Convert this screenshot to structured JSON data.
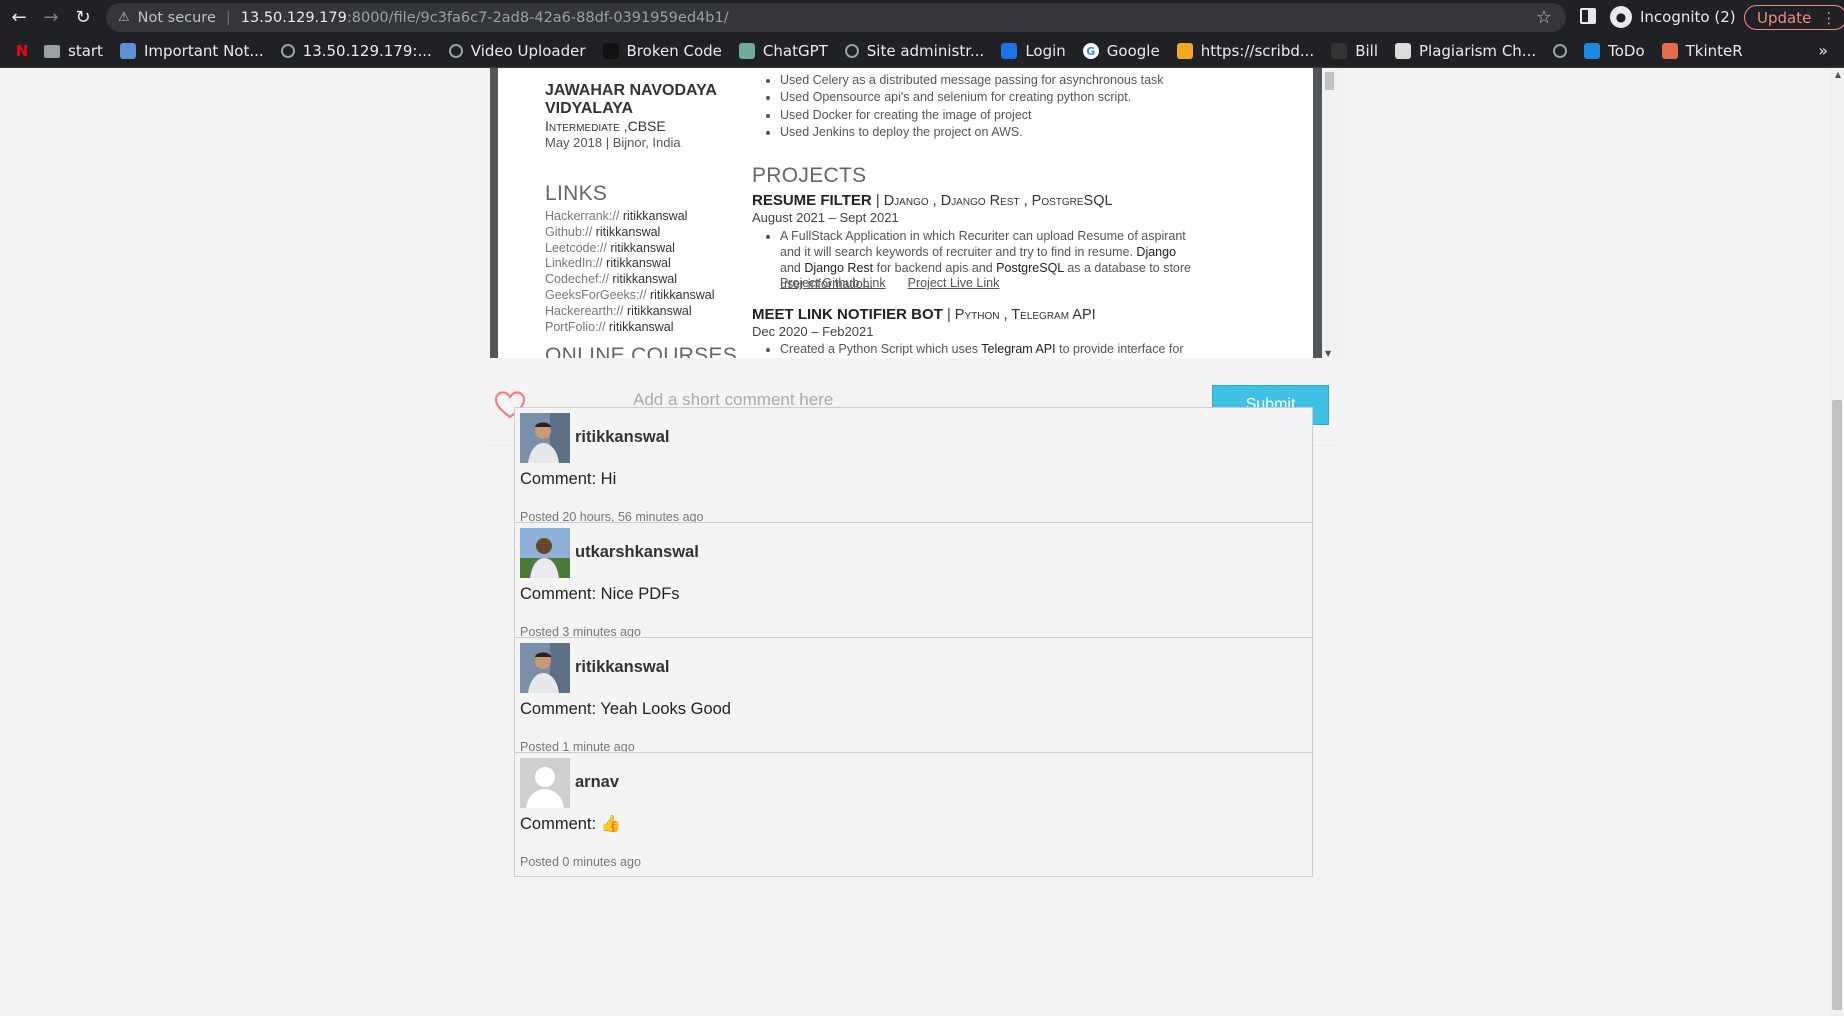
{
  "browser": {
    "security_label": "Not secure",
    "url_host": "13.50.129.179",
    "url_rest": ":8000/file/9c3fa6c7-2ad8-42a6-88df-0391959ed4b1/",
    "incognito_label": "Incognito (2)",
    "update_label": "Update",
    "bookmarks": [
      {
        "label": "start",
        "icon": "folder-icon",
        "color": "#9aa0a6"
      },
      {
        "label": "Important Not...",
        "icon": "notes-icon",
        "color": "#5f8fd6"
      },
      {
        "label": "13.50.129.179:...",
        "icon": "globe-icon",
        "color": "#9aa0a6"
      },
      {
        "label": "Video Uploader",
        "icon": "globe-icon",
        "color": "#9aa0a6"
      },
      {
        "label": "Broken Code",
        "icon": "code-icon",
        "color": "#111111"
      },
      {
        "label": "ChatGPT",
        "icon": "chatgpt-icon",
        "color": "#74aa9c"
      },
      {
        "label": "Site administr...",
        "icon": "globe-icon",
        "color": "#9aa0a6"
      },
      {
        "label": "Login",
        "icon": "login-icon",
        "color": "#1a73e8"
      },
      {
        "label": "Google",
        "icon": "google-icon",
        "color": "#ffffff"
      },
      {
        "label": "https://scribd...",
        "icon": "scribd-icon",
        "color": "#f5a623"
      },
      {
        "label": "Bill",
        "icon": "bill-icon",
        "color": "#333333"
      },
      {
        "label": "Plagiarism Ch...",
        "icon": "plagiarism-icon",
        "color": "#dddddd"
      },
      {
        "label": "",
        "icon": "globe-icon",
        "color": "#9aa0a6"
      },
      {
        "label": "ToDo",
        "icon": "todo-icon",
        "color": "#1e88e5"
      },
      {
        "label": "TkinteR",
        "icon": "tkinter-icon",
        "color": "#e56b4e"
      }
    ]
  },
  "resume": {
    "left": {
      "school": "JAWAHAR NAVODAYA VIDYALAYA",
      "school_sub": "Intermediate ,CBSE",
      "school_date": "May 2018 | Bijnor, India",
      "links_heading": "LINKS",
      "links": [
        {
          "site": "Hackerrank://",
          "user": "ritikkanswal"
        },
        {
          "site": "Github://",
          "user": "ritikkanswal"
        },
        {
          "site": "Leetcode://",
          "user": "ritikkanswal"
        },
        {
          "site": "LinkedIn://",
          "user": "ritikkanswal"
        },
        {
          "site": "Codechef://",
          "user": "ritikkanswal"
        },
        {
          "site": "GeeksForGeeks://",
          "user": "ritikkanswal"
        },
        {
          "site": "Hackerearth://",
          "user": "ritikkanswal"
        },
        {
          "site": "PortFolio://",
          "user": "ritikkanswal"
        }
      ],
      "courses_heading": "ONLINE COURSES"
    },
    "right": {
      "bullets": [
        "Used Celery as a distributed message passing for asynchronous task",
        "Used Opensource api's and selenium for creating python script.",
        "Used Docker for creating the image of project",
        "Used Jenkins to deploy the project on AWS."
      ],
      "projects_heading": "PROJECTS",
      "project1_title": "RESUME FILTER",
      "project1_stack": "| Django , Django Rest , PostgreSQL",
      "project1_date": "August 2021 – Sept 2021",
      "project1_desc_a": "A FullStack Application in which Recuriter can upload Resume of aspirant and it will search keywords of recruiter and try to find in resume.",
      "project1_desc_b": "Django",
      "project1_desc_c": "and",
      "project1_desc_d": "Django Rest",
      "project1_desc_e": "for backend apis and",
      "project1_desc_f": "PostgreSQL",
      "project1_desc_g": "as a database to store user information.",
      "project1_link1": "Project Github Link",
      "project1_link2": "Project Live Link",
      "project2_title": "MEET LINK NOTIFIER BOT",
      "project2_stack": "| Python , Telegram API",
      "project2_date": "Dec 2020 – Feb2021",
      "project2_desc_a": "Created a Python Script which uses",
      "project2_desc_b": "Telegram API",
      "project2_desc_c": "to provide interface for all"
    }
  },
  "form": {
    "comment_placeholder": "Add a short comment here",
    "submit_label": "Submit"
  },
  "comments": [
    {
      "username": "ritikkanswal",
      "comment": "Comment: Hi",
      "posted": "Posted 20 hours, 56 minutes ago",
      "avatar": "ritik"
    },
    {
      "username": "utkarshkanswal",
      "comment": "Comment: Nice PDFs",
      "posted": "Posted 3 minutes ago",
      "avatar": "utkarsh"
    },
    {
      "username": "ritikkanswal",
      "comment": "Comment: Yeah Looks Good",
      "posted": "Posted 1 minute ago",
      "avatar": "ritik"
    },
    {
      "username": "arnav",
      "comment": "Comment: 👍",
      "posted": "Posted 0 minutes ago",
      "avatar": "default"
    }
  ],
  "colors": {
    "accent": "#3ec1e5",
    "heart": "#f08080"
  }
}
